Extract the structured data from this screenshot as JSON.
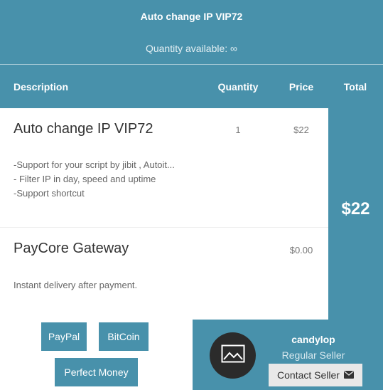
{
  "header": {
    "title": "Auto change IP VIP72",
    "quantity_available": "Quantity available: ∞"
  },
  "columns": {
    "description": "Description",
    "quantity": "Quantity",
    "price": "Price",
    "total": "Total"
  },
  "items": [
    {
      "name": "Auto change IP VIP72",
      "quantity": "1",
      "price": "$22",
      "description_lines": [
        "-Support for your script by jibit , Autoit...",
        "- Filter IP in day, speed and uptime",
        "-Support shortcut"
      ]
    },
    {
      "name": "PayCore Gateway",
      "price": "$0.00",
      "description_lines": [
        "Instant delivery after payment."
      ]
    }
  ],
  "total": "$22",
  "payment": {
    "paypal": "PayPal",
    "bitcoin": "BitCoin",
    "perfect_money": "Perfect Money"
  },
  "seller": {
    "name": "candylop",
    "role": "Regular Seller",
    "contact_label": "Contact Seller",
    "avatar_icon": "image-icon",
    "contact_icon": "envelope-icon"
  },
  "colors": {
    "accent": "#4891ab",
    "dark_avatar": "#2b2b2b"
  }
}
